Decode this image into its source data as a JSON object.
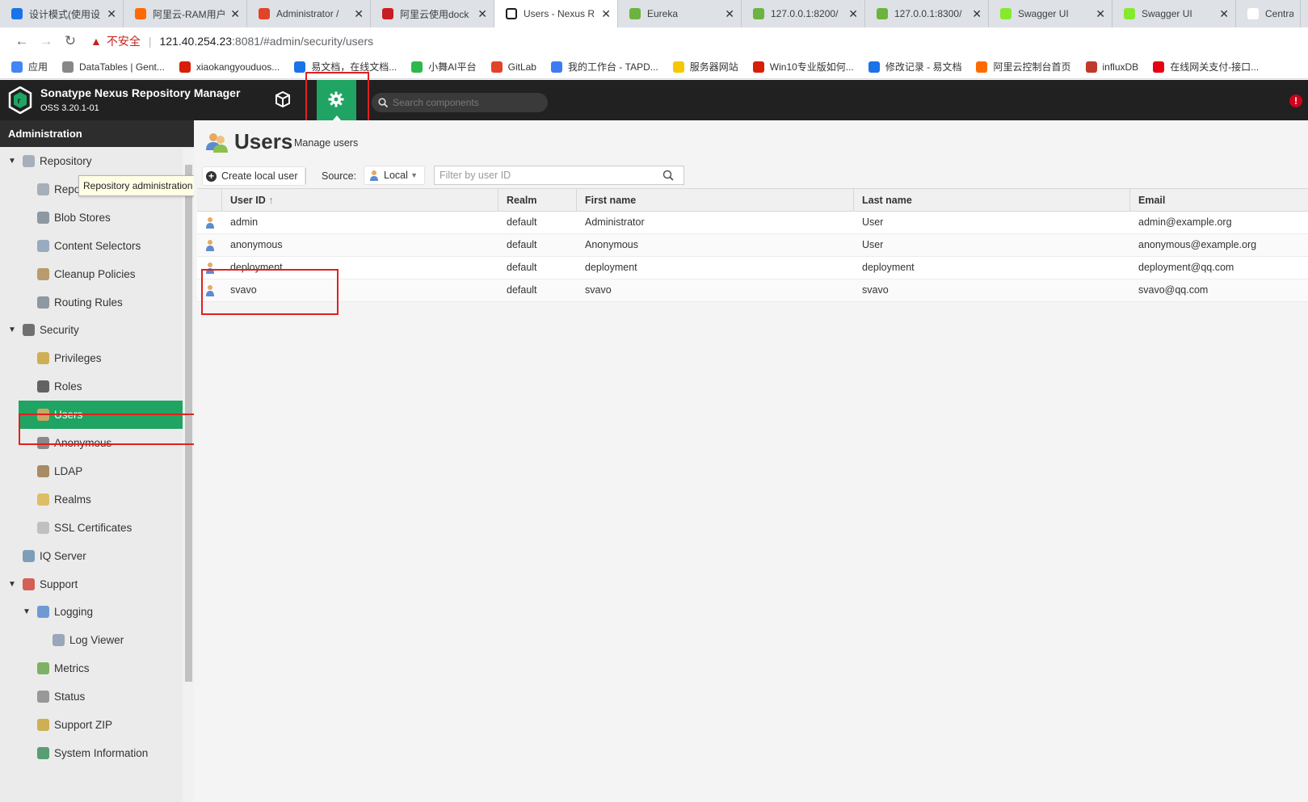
{
  "browser": {
    "tabs": [
      {
        "title": "设计模式(使用设",
        "color": "#1a73e8"
      },
      {
        "title": "阿里云-RAM用户",
        "color": "#ff6a00"
      },
      {
        "title": "Administrator /",
        "color": "#e24329"
      },
      {
        "title": "阿里云使用dock",
        "color": "#c71d23"
      },
      {
        "title": "Users - Nexus R",
        "color": "#1b1c1d"
      },
      {
        "title": "Eureka",
        "color": "#6db33f"
      },
      {
        "title": "127.0.0.1:8200/",
        "color": "#6db33f"
      },
      {
        "title": "127.0.0.1:8300/",
        "color": "#6db33f"
      },
      {
        "title": "Swagger UI",
        "color": "#85ea2d"
      },
      {
        "title": "Swagger UI",
        "color": "#85ea2d"
      },
      {
        "title": "Central",
        "color": "#ffffff"
      }
    ],
    "address": {
      "insecure_label": "不安全",
      "host": "121.40.254.23",
      "rest": ":8081/#admin/security/users"
    },
    "bookmarks": [
      {
        "label": "应用",
        "color": "#4285f4"
      },
      {
        "label": "DataTables | Gent...",
        "color": "#888888"
      },
      {
        "label": "xiaokangyouduos...",
        "color": "#d81e06"
      },
      {
        "label": "易文档，在线文档...",
        "color": "#1a73e8"
      },
      {
        "label": "小舞AI平台",
        "color": "#2db84d"
      },
      {
        "label": "GitLab",
        "color": "#e24329"
      },
      {
        "label": "我的工作台 - TAPD...",
        "color": "#3d7af5"
      },
      {
        "label": "服务器网站",
        "color": "#f6c700"
      },
      {
        "label": "Win10专业版如何...",
        "color": "#d81e06"
      },
      {
        "label": "修改记录 - 易文档",
        "color": "#1a73e8"
      },
      {
        "label": "阿里云控制台首页",
        "color": "#ff6a00"
      },
      {
        "label": "influxDB",
        "color": "#c0392b"
      },
      {
        "label": "在线网关支付-接口...",
        "color": "#e60012"
      }
    ]
  },
  "app": {
    "title": "Sonatype Nexus Repository Manager",
    "version": "OSS 3.20.1-01",
    "search_placeholder": "Search components",
    "accent": "#1fa463",
    "alert": "!"
  },
  "sidebar": {
    "header": "Administration",
    "tooltip": "Repository administration",
    "items": [
      {
        "label": "Repository",
        "level": 0,
        "expanded": true,
        "icon": "database-icon"
      },
      {
        "label": "Repositories",
        "level": 1,
        "icon": "database-icon"
      },
      {
        "label": "Blob Stores",
        "level": 1,
        "icon": "server-icon"
      },
      {
        "label": "Content Selectors",
        "level": 1,
        "icon": "selector-icon"
      },
      {
        "label": "Cleanup Policies",
        "level": 1,
        "icon": "broom-icon"
      },
      {
        "label": "Routing Rules",
        "level": 1,
        "icon": "router-icon"
      },
      {
        "label": "Security",
        "level": 0,
        "expanded": true,
        "icon": "badge-icon"
      },
      {
        "label": "Privileges",
        "level": 1,
        "icon": "medal-icon"
      },
      {
        "label": "Roles",
        "level": 1,
        "icon": "user-suit-icon"
      },
      {
        "label": "Users",
        "level": 1,
        "icon": "users-icon",
        "active": true
      },
      {
        "label": "Anonymous",
        "level": 1,
        "icon": "user-gray-icon"
      },
      {
        "label": "LDAP",
        "level": 1,
        "icon": "book-icon"
      },
      {
        "label": "Realms",
        "level": 1,
        "icon": "shield-icon"
      },
      {
        "label": "SSL Certificates",
        "level": 1,
        "icon": "certificate-icon"
      },
      {
        "label": "IQ Server",
        "level": 0,
        "icon": "iq-icon"
      },
      {
        "label": "Support",
        "level": 0,
        "expanded": true,
        "icon": "lifebuoy-icon"
      },
      {
        "label": "Logging",
        "level": 1,
        "expanded": true,
        "icon": "log-icon"
      },
      {
        "label": "Log Viewer",
        "level": 2,
        "icon": "scroll-icon"
      },
      {
        "label": "Metrics",
        "level": 1,
        "icon": "pie-chart-icon"
      },
      {
        "label": "Status",
        "level": 1,
        "icon": "building-icon"
      },
      {
        "label": "Support ZIP",
        "level": 1,
        "icon": "zip-icon"
      },
      {
        "label": "System Information",
        "level": 1,
        "icon": "globe-icon"
      }
    ]
  },
  "page": {
    "title": "Users",
    "subtitle": "Manage users",
    "create_button": "Create local user",
    "source_label": "Source:",
    "source_value": "Local",
    "filter_placeholder": "Filter by user ID"
  },
  "table": {
    "columns": [
      "User ID",
      "Realm",
      "First name",
      "Last name",
      "Email"
    ],
    "sort_indicator": "↑",
    "rows": [
      {
        "user_id": "admin",
        "realm": "default",
        "first_name": "Administrator",
        "last_name": "User",
        "email": "admin@example.org"
      },
      {
        "user_id": "anonymous",
        "realm": "default",
        "first_name": "Anonymous",
        "last_name": "User",
        "email": "anonymous@example.org"
      },
      {
        "user_id": "deployment",
        "realm": "default",
        "first_name": "deployment",
        "last_name": "deployment",
        "email": "deployment@qq.com"
      },
      {
        "user_id": "svavo",
        "realm": "default",
        "first_name": "svavo",
        "last_name": "svavo",
        "email": "svavo@qq.com"
      }
    ]
  }
}
